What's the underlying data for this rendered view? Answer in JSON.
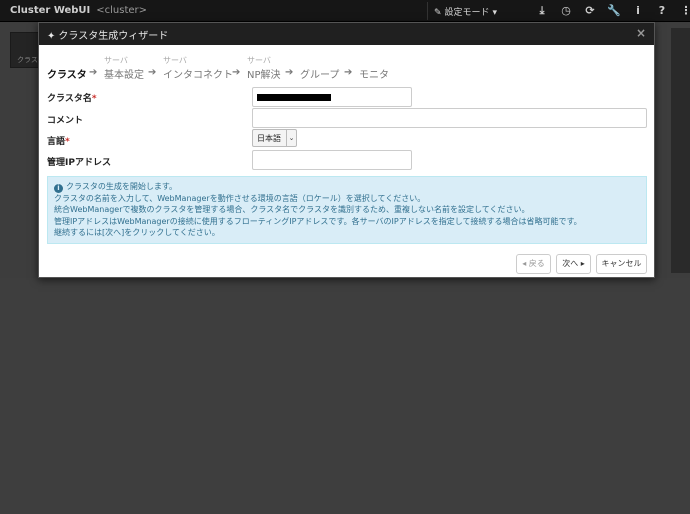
{
  "navbar": {
    "brand": "Cluster WebUI",
    "cluster": "<cluster>",
    "mode_label": "設定モード",
    "mode_caret": "▾",
    "icons": [
      "download-icon",
      "clock-icon",
      "refresh-icon",
      "wrench-icon",
      "info-icon",
      "help-icon",
      "menu-icon"
    ]
  },
  "background": {
    "card_label": "クラス"
  },
  "modal": {
    "title": "クラスタ生成ウィザード",
    "close": "×",
    "steps": [
      {
        "sup": "",
        "label": "クラスタ",
        "active": true
      },
      {
        "sup": "サーバ",
        "label": "基本設定",
        "active": false
      },
      {
        "sup": "サーバ",
        "label": "インタコネクト",
        "active": false
      },
      {
        "sup": "サーバ",
        "label": "NP解決",
        "active": false
      },
      {
        "sup": "",
        "label": "グループ",
        "active": false
      },
      {
        "sup": "",
        "label": "モニタ",
        "active": false
      }
    ],
    "form": {
      "cluster_name_label": "クラスタ名",
      "required_mark": "*",
      "comment_label": "コメント",
      "language_label": "言語",
      "language_value": "日本語",
      "mgmt_ip_label": "管理IPアドレス"
    },
    "alert": {
      "lines": [
        "クラスタの生成を開始します。",
        "クラスタの名前を入力して、WebManagerを動作させる環境の言語（ロケール）を選択してください。",
        "統合WebManagerで複数のクラスタを管理する場合、クラスタ名でクラスタを識別するため、重複しない名前を設定してください。",
        "管理IPアドレスはWebManagerの接続に使用するフローティングIPアドレスです。各サーバのIPアドレスを指定して接続する場合は省略可能です。",
        "継続するには[次へ]をクリックしてください。"
      ]
    },
    "buttons": {
      "back": "◂ 戻る",
      "next": "次へ ▸",
      "cancel": "キャンセル"
    }
  }
}
